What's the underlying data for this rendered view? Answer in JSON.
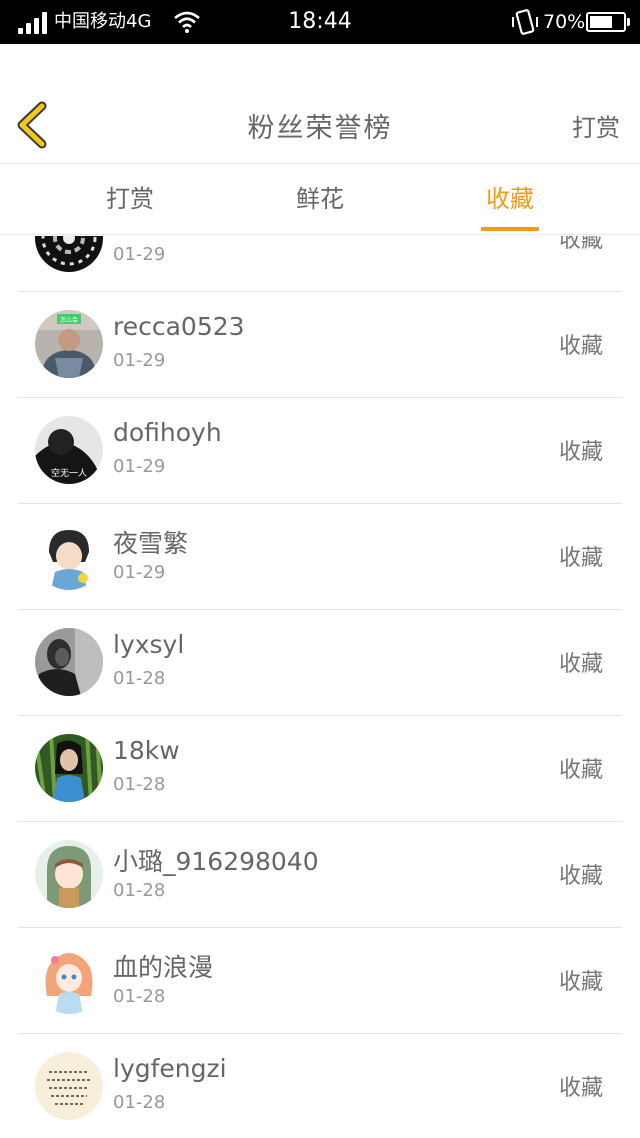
{
  "status_bar": {
    "carrier": "中国移动4G",
    "time": "18:44",
    "battery": "70%",
    "battery_level": 0.7
  },
  "nav": {
    "title": "粉丝荣誉榜",
    "action": "打赏"
  },
  "tabs": [
    {
      "label": "打赏",
      "active": false
    },
    {
      "label": "鲜花",
      "active": false
    },
    {
      "label": "收藏",
      "active": true
    }
  ],
  "list": [
    {
      "name": "",
      "date": "01-29",
      "action": "收藏",
      "avatar": "dark-pattern"
    },
    {
      "name": "recca0523",
      "date": "01-29",
      "action": "收藏",
      "avatar": "photo-man-green"
    },
    {
      "name": "dofihoyh",
      "date": "01-29",
      "action": "收藏",
      "avatar": "photo-bw-text"
    },
    {
      "name": "夜雪繁",
      "date": "01-29",
      "action": "收藏",
      "avatar": "anime-boy"
    },
    {
      "name": "lyxsyl",
      "date": "01-28",
      "action": "收藏",
      "avatar": "photo-bw-man"
    },
    {
      "name": "18kw",
      "date": "01-28",
      "action": "收藏",
      "avatar": "photo-woman-forest"
    },
    {
      "name": "小璐_916298040",
      "date": "01-28",
      "action": "收藏",
      "avatar": "anime-hood"
    },
    {
      "name": "血的浪漫",
      "date": "01-28",
      "action": "收藏",
      "avatar": "anime-girl-pink"
    },
    {
      "name": "lygfengzi",
      "date": "01-28",
      "action": "收藏",
      "avatar": "text-calligraphy"
    }
  ],
  "avatar_texts": {
    "row1": "怎么会",
    "row2": "空无一人"
  },
  "colors": {
    "accent": "#f39a11",
    "back_icon": "#f2c81a"
  }
}
